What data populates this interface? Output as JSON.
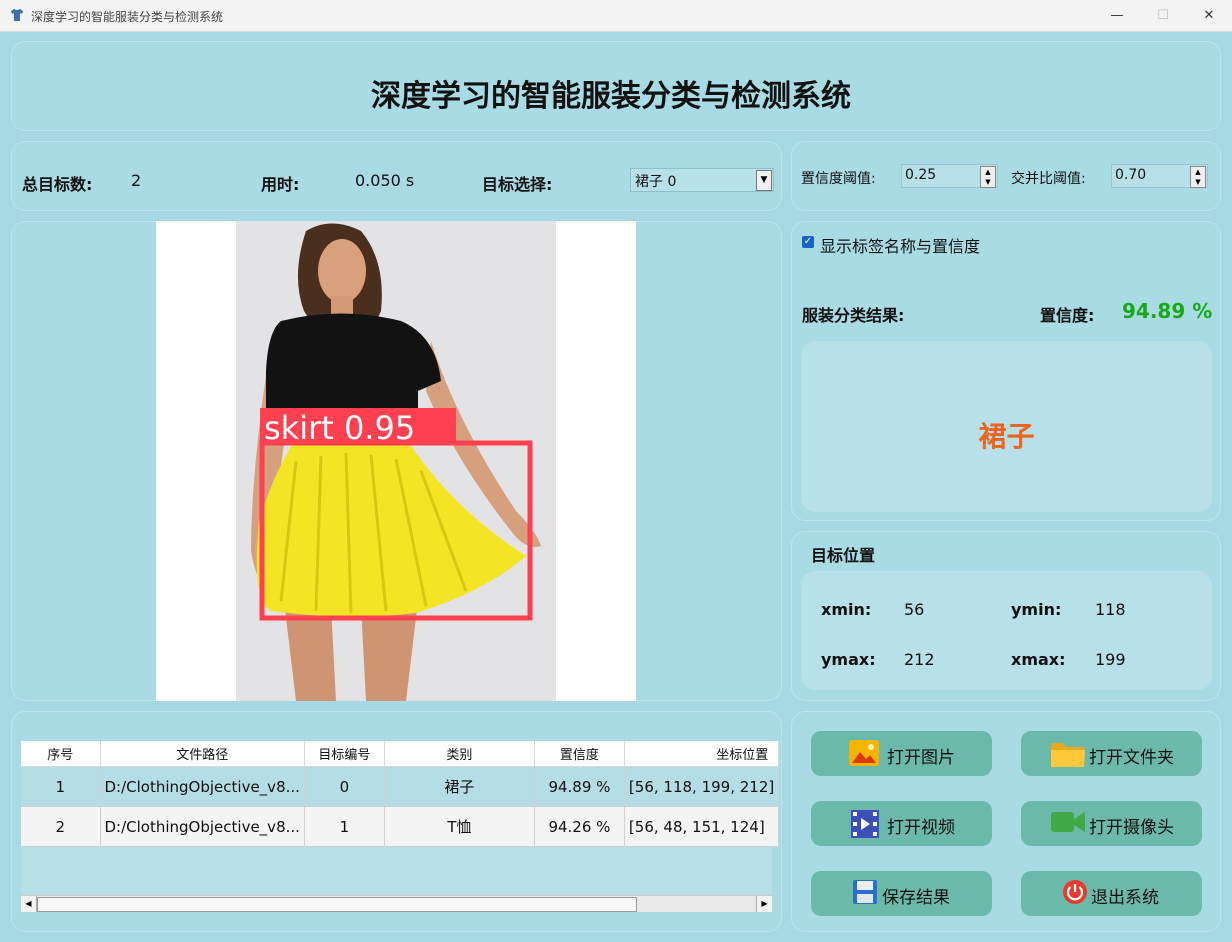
{
  "window": {
    "title": "深度学习的智能服装分类与检测系统",
    "minimize": "—",
    "maximize": "☐",
    "close": "✕"
  },
  "header": {
    "title": "深度学习的智能服装分类与检测系统"
  },
  "stats": {
    "total_label": "总目标数:",
    "total_value": "2",
    "time_label": "用时:",
    "time_value": "0.050 s",
    "target_label": "目标选择:",
    "target_value": "裙子 0"
  },
  "thresholds": {
    "conf_label": "置信度阈值:",
    "conf_value": "0.25",
    "iou_label": "交并比阈值:",
    "iou_value": "0.70"
  },
  "detection": {
    "box_label": "skirt 0.95",
    "box_color": "#ff4050"
  },
  "options": {
    "show_label_text": "显示标签名称与置信度",
    "show_label_checked": true
  },
  "classification": {
    "result_label": "服装分类结果:",
    "conf_label": "置信度:",
    "conf_value": "94.89 %",
    "result_value": "裙子",
    "result_color": "#f06420",
    "conf_color": "#18a818"
  },
  "position": {
    "title": "目标位置",
    "xmin_label": "xmin:",
    "xmin_value": "56",
    "ymin_label": "ymin:",
    "ymin_value": "118",
    "ymax_label": "ymax:",
    "ymax_value": "212",
    "xmax_label": "xmax:",
    "xmax_value": "199"
  },
  "table": {
    "headers": [
      "序号",
      "文件路径",
      "目标编号",
      "类别",
      "置信度",
      "坐标位置"
    ],
    "rows": [
      [
        "1",
        "D:/ClothingObjective_v8...",
        "0",
        "裙子",
        "94.89 %",
        "[56, 118, 199, 212]"
      ],
      [
        "2",
        "D:/ClothingObjective_v8...",
        "1",
        "T恤",
        "94.26 %",
        "[56, 48, 151, 124]"
      ]
    ]
  },
  "buttons": {
    "open_image": "打开图片",
    "open_folder": "打开文件夹",
    "open_video": "打开视频",
    "open_camera": "打开摄像头",
    "save": "保存结果",
    "exit": "退出系统"
  },
  "icons": [
    "tshirt-icon",
    "image-icon",
    "folder-icon",
    "video-icon",
    "camera-icon",
    "save-icon",
    "power-icon"
  ]
}
